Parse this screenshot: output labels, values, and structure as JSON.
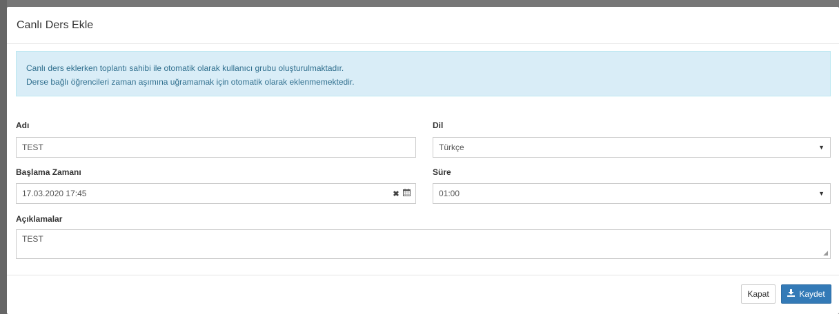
{
  "modal": {
    "title": "Canlı Ders Ekle"
  },
  "alert": {
    "line1": "Canlı ders eklerken toplantı sahibi ile otomatik olarak kullanıcı grubu oluşturulmaktadır.",
    "line2": "Derse bağlı öğrencileri zaman aşımına uğramamak için otomatik olarak eklenmemektedir."
  },
  "form": {
    "name_label": "Adı",
    "name_value": "TEST",
    "language_label": "Dil",
    "language_value": "Türkçe",
    "start_label": "Başlama Zamanı",
    "start_value": "17.03.2020 17:45",
    "duration_label": "Süre",
    "duration_value": "01:00",
    "description_label": "Açıklamalar",
    "description_value": "TEST"
  },
  "footer": {
    "close_label": "Kapat",
    "save_label": "Kaydet"
  },
  "icons": {
    "clear": "clear-icon",
    "calendar": "calendar-icon",
    "dropdown": "chevron-down-icon",
    "save": "download-icon"
  },
  "colors": {
    "primary": "#337ab7",
    "alert_bg": "#d9edf7",
    "alert_text": "#31708f"
  }
}
